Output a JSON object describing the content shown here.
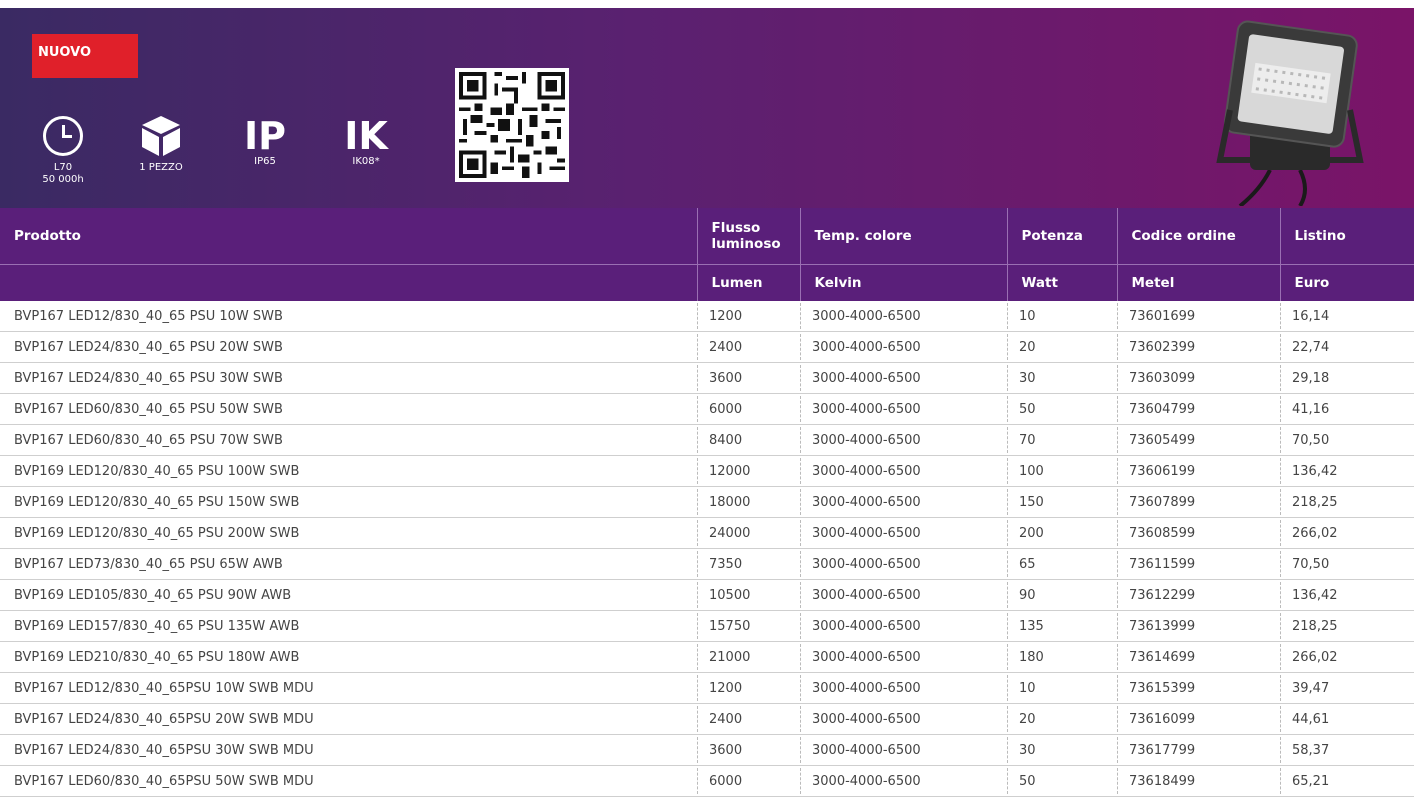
{
  "banner": {
    "badge": "NUOVO",
    "icons": [
      {
        "name": "clock",
        "caption": "L70",
        "caption2": "50 000h"
      },
      {
        "name": "box",
        "caption": "1 PEZZO"
      },
      {
        "name": "ip",
        "letters": "IP",
        "caption": "IP65"
      },
      {
        "name": "ik",
        "letters": "IK",
        "caption": "IK08*"
      }
    ]
  },
  "table": {
    "headers": [
      "Prodotto",
      "Flusso luminoso",
      "Temp. colore",
      "Potenza",
      "Codice ordine",
      "Listino"
    ],
    "units": [
      "",
      "Lumen",
      "Kelvin",
      "Watt",
      "Metel",
      "Euro"
    ],
    "rows": [
      [
        "BVP167 LED12/830_40_65 PSU 10W SWB",
        "1200",
        "3000-4000-6500",
        "10",
        "73601699",
        "16,14"
      ],
      [
        "BVP167 LED24/830_40_65 PSU 20W SWB",
        "2400",
        "3000-4000-6500",
        "20",
        "73602399",
        "22,74"
      ],
      [
        "BVP167 LED24/830_40_65 PSU 30W SWB",
        "3600",
        "3000-4000-6500",
        "30",
        "73603099",
        "29,18"
      ],
      [
        "BVP167 LED60/830_40_65 PSU 50W SWB",
        "6000",
        "3000-4000-6500",
        "50",
        "73604799",
        "41,16"
      ],
      [
        "BVP167 LED60/830_40_65 PSU 70W SWB",
        "8400",
        "3000-4000-6500",
        "70",
        "73605499",
        "70,50"
      ],
      [
        "BVP169 LED120/830_40_65 PSU 100W SWB",
        "12000",
        "3000-4000-6500",
        "100",
        "73606199",
        "136,42"
      ],
      [
        "BVP169 LED120/830_40_65 PSU 150W SWB",
        "18000",
        "3000-4000-6500",
        "150",
        "73607899",
        "218,25"
      ],
      [
        "BVP169 LED120/830_40_65 PSU 200W SWB",
        "24000",
        "3000-4000-6500",
        "200",
        "73608599",
        "266,02"
      ],
      [
        "BVP167 LED73/830_40_65 PSU 65W AWB",
        "7350",
        "3000-4000-6500",
        "65",
        "73611599",
        "70,50"
      ],
      [
        "BVP169 LED105/830_40_65 PSU 90W AWB",
        "10500",
        "3000-4000-6500",
        "90",
        "73612299",
        "136,42"
      ],
      [
        "BVP169 LED157/830_40_65 PSU 135W AWB",
        "15750",
        "3000-4000-6500",
        "135",
        "73613999",
        "218,25"
      ],
      [
        "BVP169 LED210/830_40_65 PSU 180W AWB",
        "21000",
        "3000-4000-6500",
        "180",
        "73614699",
        "266,02"
      ],
      [
        "BVP167 LED12/830_40_65PSU 10W SWB MDU",
        "1200",
        "3000-4000-6500",
        "10",
        "73615399",
        "39,47"
      ],
      [
        "BVP167 LED24/830_40_65PSU 20W SWB MDU",
        "2400",
        "3000-4000-6500",
        "20",
        "73616099",
        "44,61"
      ],
      [
        "BVP167 LED24/830_40_65PSU 30W SWB MDU",
        "3600",
        "3000-4000-6500",
        "30",
        "73617799",
        "58,37"
      ],
      [
        "BVP167 LED60/830_40_65PSU 50W SWB MDU",
        "6000",
        "3000-4000-6500",
        "50",
        "73618499",
        "65,21"
      ]
    ]
  }
}
